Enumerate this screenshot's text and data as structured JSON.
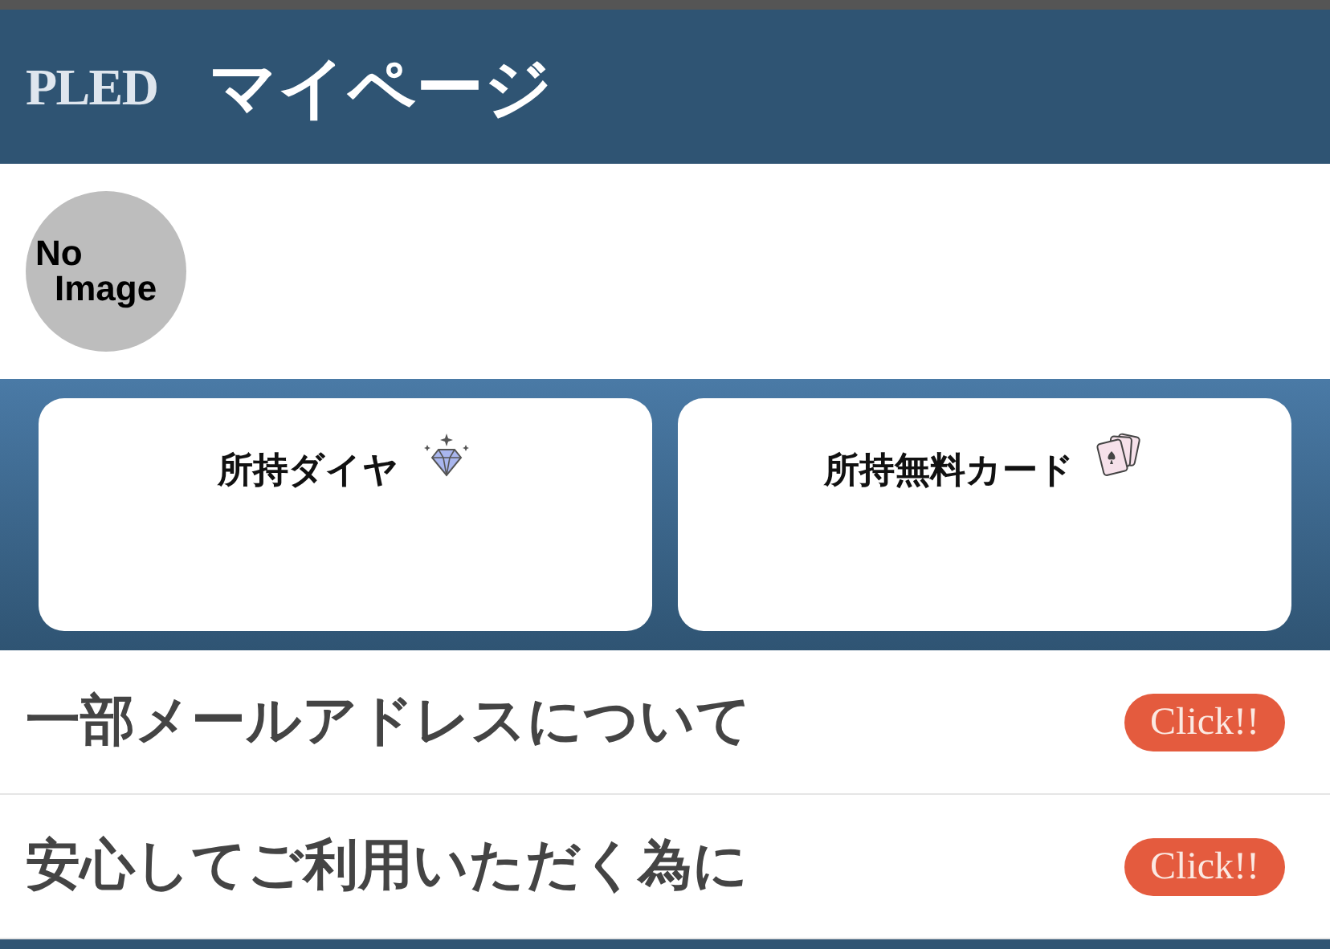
{
  "header": {
    "logo": "PLED",
    "title": "マイページ"
  },
  "profile": {
    "avatar_text": [
      "No",
      "Image"
    ]
  },
  "cards": [
    {
      "label": "所持ダイヤ",
      "kind": "diamond"
    },
    {
      "label": "所持無料カード",
      "kind": "cards"
    }
  ],
  "links": [
    {
      "label": "一部メールアドレスについて",
      "button": "Click!!"
    },
    {
      "label": "安心してご利用いただく為に",
      "button": "Click!!"
    }
  ]
}
